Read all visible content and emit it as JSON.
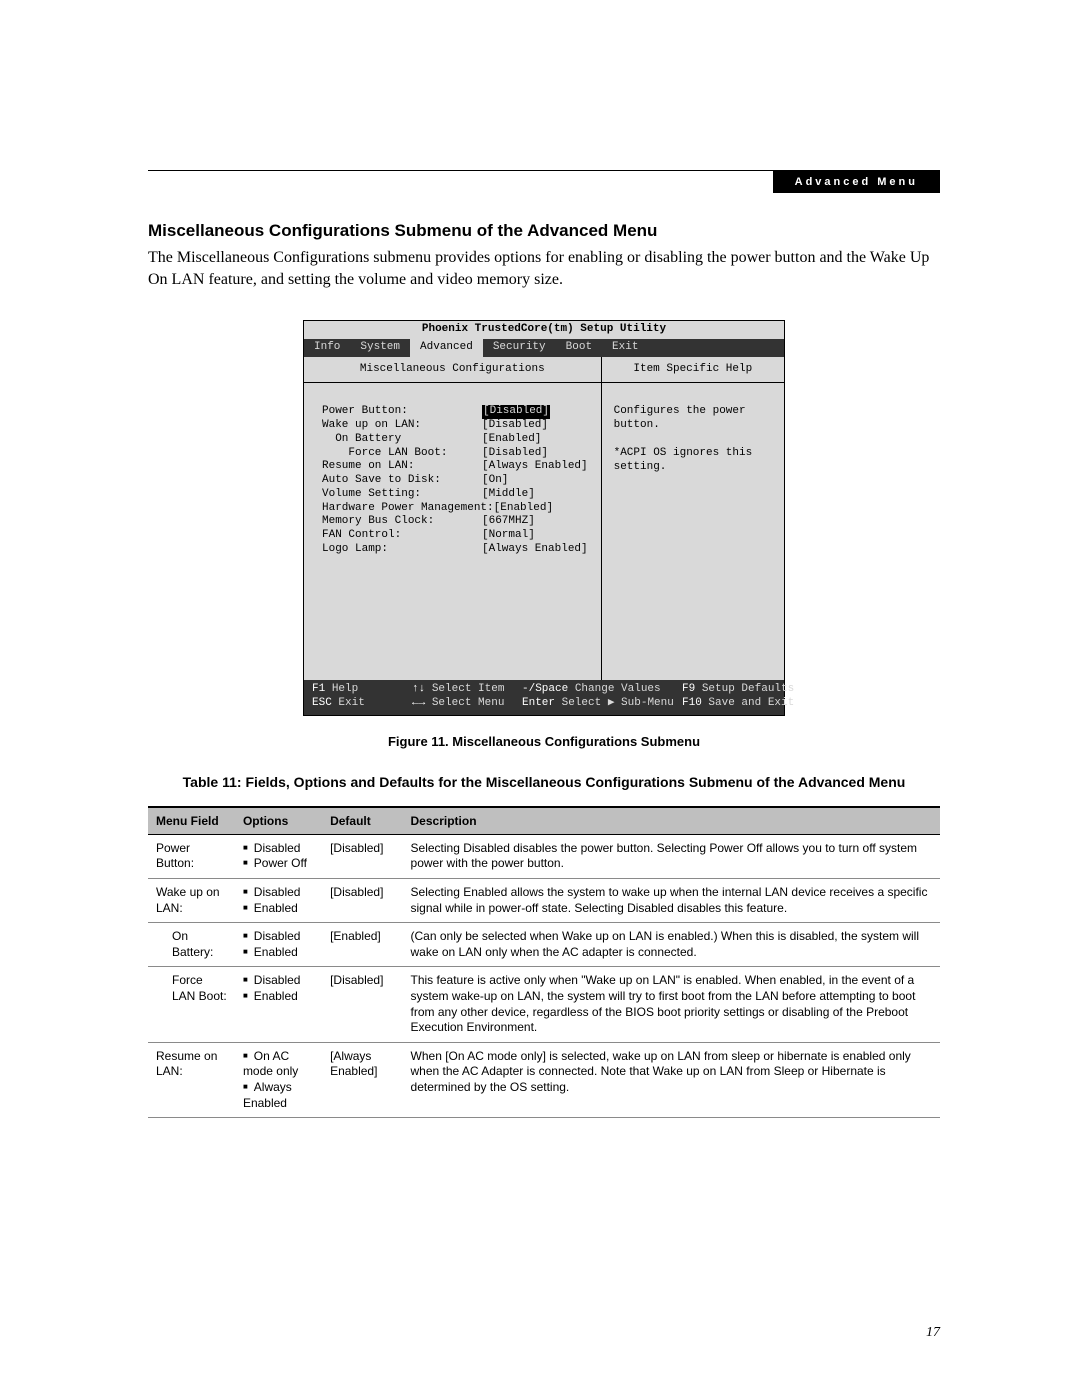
{
  "header_box_label": "Advanced Menu",
  "section_heading": "Miscellaneous Configurations Submenu of the Advanced Menu",
  "intro_paragraph": "The Miscellaneous Configurations submenu provides options for enabling or disabling the power button and the Wake Up On LAN feature, and setting the volume and video memory size.",
  "bios": {
    "title": "Phoenix TrustedCore(tm) Setup Utility",
    "tabs": [
      "Info",
      "System",
      "Advanced",
      "Security",
      "Boot",
      "Exit"
    ],
    "active_tab_index": 2,
    "left_title": "Miscellaneous Configurations",
    "right_title": "Item Specific Help",
    "help_text_1": "Configures the power button.",
    "help_text_2": "*ACPI OS ignores this setting.",
    "settings": [
      {
        "label": "Power Button:",
        "indent": 0,
        "value": "[Disabled]",
        "highlight": true
      },
      {
        "label": "Wake up on LAN:",
        "indent": 0,
        "value": "[Disabled]",
        "highlight": false
      },
      {
        "label": "On Battery",
        "indent": 1,
        "value": "[Enabled]",
        "highlight": false
      },
      {
        "label": "Force LAN Boot:",
        "indent": 2,
        "value": "[Disabled]",
        "highlight": false
      },
      {
        "label": "Resume on LAN:",
        "indent": 0,
        "value": "[Always Enabled]",
        "highlight": false
      },
      {
        "label": "Auto Save to Disk:",
        "indent": 0,
        "value": "[On]",
        "highlight": false
      },
      {
        "label": "Volume Setting:",
        "indent": 0,
        "value": "[Middle]",
        "highlight": false
      },
      {
        "label": "Hardware Power Management:",
        "indent": 0,
        "value": "[Enabled]",
        "highlight": false
      },
      {
        "label": "Memory Bus Clock:",
        "indent": 0,
        "value": "[667MHZ]",
        "highlight": false
      },
      {
        "label": "FAN Control:",
        "indent": 0,
        "value": "[Normal]",
        "highlight": false
      },
      {
        "label": "Logo Lamp:",
        "indent": 0,
        "value": "[Always Enabled]",
        "highlight": false
      }
    ],
    "footer": {
      "r1": {
        "k1": "F1",
        "a1": "Help",
        "k2": "↑↓",
        "a2": "Select Item",
        "k3": "-/Space",
        "a3": "Change Values",
        "k4": "F9",
        "a4": "Setup Defaults"
      },
      "r2": {
        "k1": "ESC",
        "a1": "Exit",
        "k2": "←→",
        "a2": "Select Menu",
        "k3": "Enter",
        "a3": "Select ▶ Sub-Menu",
        "k4": "F10",
        "a4": "Save and Exit"
      }
    }
  },
  "figure_caption": "Figure 11.  Miscellaneous Configurations Submenu",
  "table_caption": "Table 11: Fields, Options and Defaults for the Miscellaneous Configurations Submenu of the Advanced Menu",
  "table": {
    "headers": [
      "Menu Field",
      "Options",
      "Default",
      "Description"
    ],
    "rows": [
      {
        "field": "Power Button:",
        "indent": false,
        "options": [
          "Disabled",
          "Power Off"
        ],
        "default": "[Disabled]",
        "description": "Selecting Disabled disables the power button. Selecting Power Off allows you to turn off system power with the power button."
      },
      {
        "field": "Wake up on LAN:",
        "indent": false,
        "options": [
          "Disabled",
          "Enabled"
        ],
        "default": "[Disabled]",
        "description": "Selecting Enabled allows the system to wake up when the internal LAN device receives a specific signal while in power-off state. Selecting Disabled disables this feature."
      },
      {
        "field": "On Battery:",
        "indent": true,
        "options": [
          "Disabled",
          "Enabled"
        ],
        "default": "[Enabled]",
        "description": "(Can only be selected when Wake up on LAN is enabled.) When this is disabled, the system will wake on LAN only when the AC adapter is connected."
      },
      {
        "field": "Force LAN Boot:",
        "indent": true,
        "options": [
          "Disabled",
          "Enabled"
        ],
        "default": "[Disabled]",
        "description": "This feature is active only when \"Wake up on LAN\" is enabled. When enabled, in the event of a system wake-up on LAN, the system will try to first boot from the LAN before attempting to boot from any other device, regardless of the BIOS boot priority settings or disabling of the Preboot Execution Environment."
      },
      {
        "field": "Resume on LAN:",
        "indent": false,
        "options": [
          "On AC mode only",
          "Always Enabled"
        ],
        "default": "[Always Enabled]",
        "description": "When [On AC mode only] is selected, wake up on LAN from sleep or hibernate is enabled only when the AC Adapter is connected. Note that Wake up on LAN from Sleep or Hibernate is determined by the OS setting."
      }
    ]
  },
  "page_number": "17"
}
